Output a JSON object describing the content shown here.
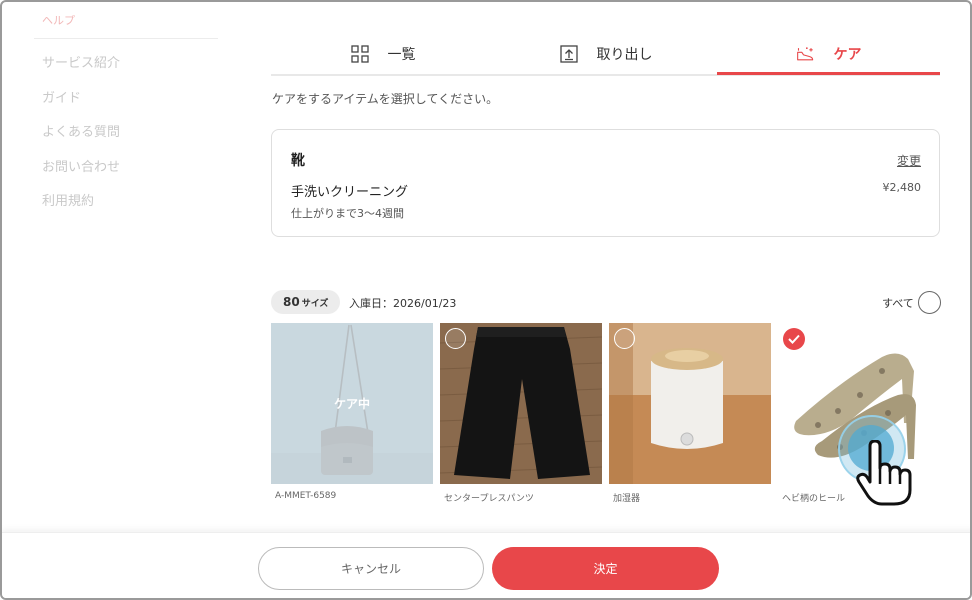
{
  "sidebar": {
    "help_heading": "ヘルプ",
    "items": [
      {
        "label": "サービス紹介"
      },
      {
        "label": "ガイド"
      },
      {
        "label": "よくある質問"
      },
      {
        "label": "お問い合わせ"
      },
      {
        "label": "利用規約"
      }
    ]
  },
  "tabs": [
    {
      "label": "一覧",
      "icon": "grid-icon"
    },
    {
      "label": "取り出し",
      "icon": "take-out-icon"
    },
    {
      "label": "ケア",
      "icon": "shoe-care-icon",
      "active": true
    }
  ],
  "instruction": "ケアをするアイテムを選択してください。",
  "care_card": {
    "category": "靴",
    "change_label": "変更",
    "service": "手洗いクリーニング",
    "price": "¥2,480",
    "eta": "仕上がりまで3〜4週間"
  },
  "box": {
    "size_value": "80",
    "size_unit": "サイズ",
    "stored_date": "入庫日：2026/01/23",
    "select_all_label": "すべて"
  },
  "items": [
    {
      "label": "A-MMET-6589",
      "overlay": "ケア中",
      "selected": false
    },
    {
      "label": "センタープレスパンツ",
      "selected": false
    },
    {
      "label": "加湿器",
      "selected": false
    },
    {
      "label": "ヘビ柄のヒール",
      "selected": true
    }
  ],
  "footer": {
    "cancel_label": "キャンセル",
    "confirm_label": "決定"
  },
  "colors": {
    "accent": "#e8474a",
    "muted_text": "#c9c9c9",
    "border": "#dedede"
  }
}
